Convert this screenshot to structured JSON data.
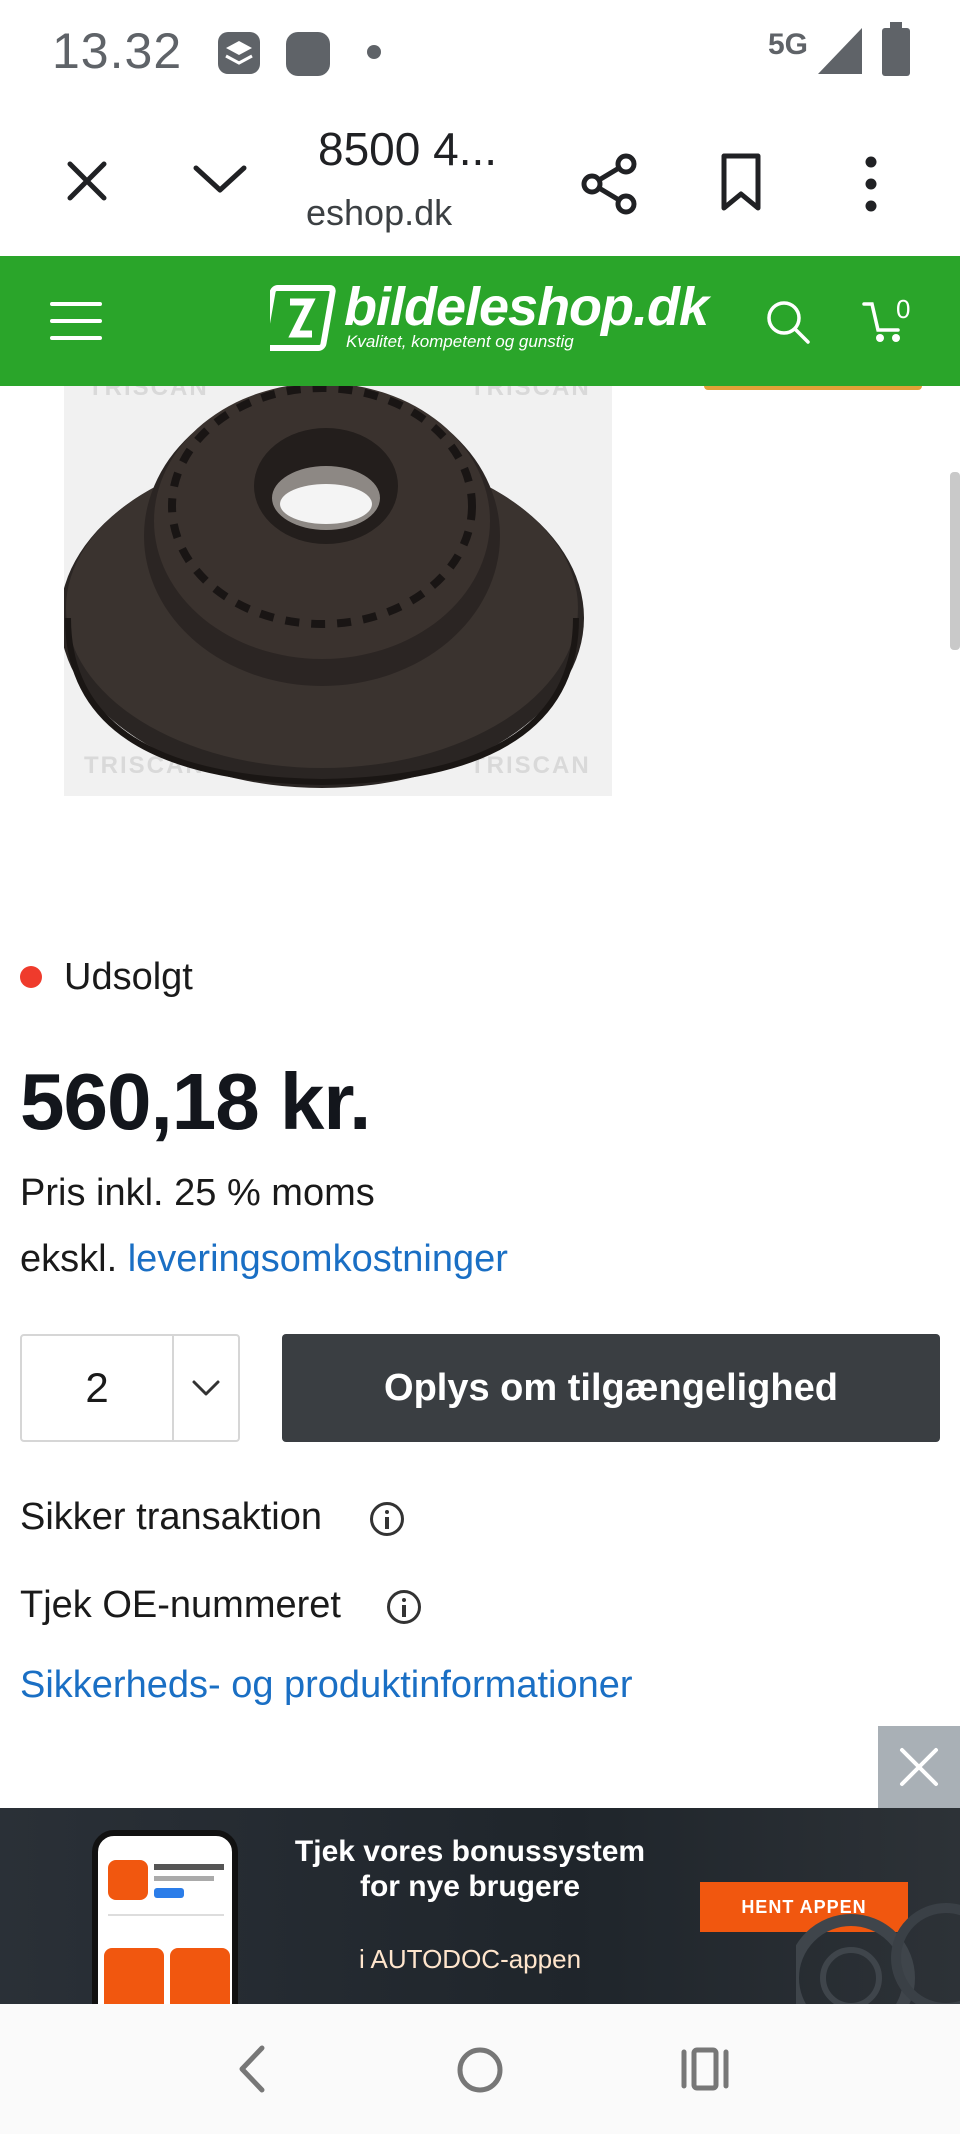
{
  "status_bar": {
    "time": "13.32",
    "network": "5G"
  },
  "custom_tab": {
    "title": "8500 4...",
    "url": "eshop.dk"
  },
  "site": {
    "logo": "bildeleshop.dk",
    "slogan": "Kvalitet, kompetent og gunstig",
    "cart_count": "0",
    "brand_color": "#2aa52a"
  },
  "product": {
    "image_watermark": "TRISCAN",
    "stock_status": "Udsolgt",
    "stock_color": "#ef3b2c",
    "price": "560,18 kr.",
    "price_note": "Pris inkl. 25 % moms",
    "shipping_prefix": "ekskl.",
    "shipping_link": "leveringsomkostninger",
    "quantity": "2",
    "availability_button": "Oplys om tilgængelighed",
    "secure_transaction": "Sikker transaktion",
    "check_oe": "Tjek OE-nummeret",
    "safety_info_link": "Sikkerheds- og produktinformationer"
  },
  "ad": {
    "heading": "Tjek vores bonussystem for nye brugere",
    "subtext": "i AUTODOC-appen",
    "cta": "HENT APPEN",
    "cta_color": "#f1570f"
  }
}
